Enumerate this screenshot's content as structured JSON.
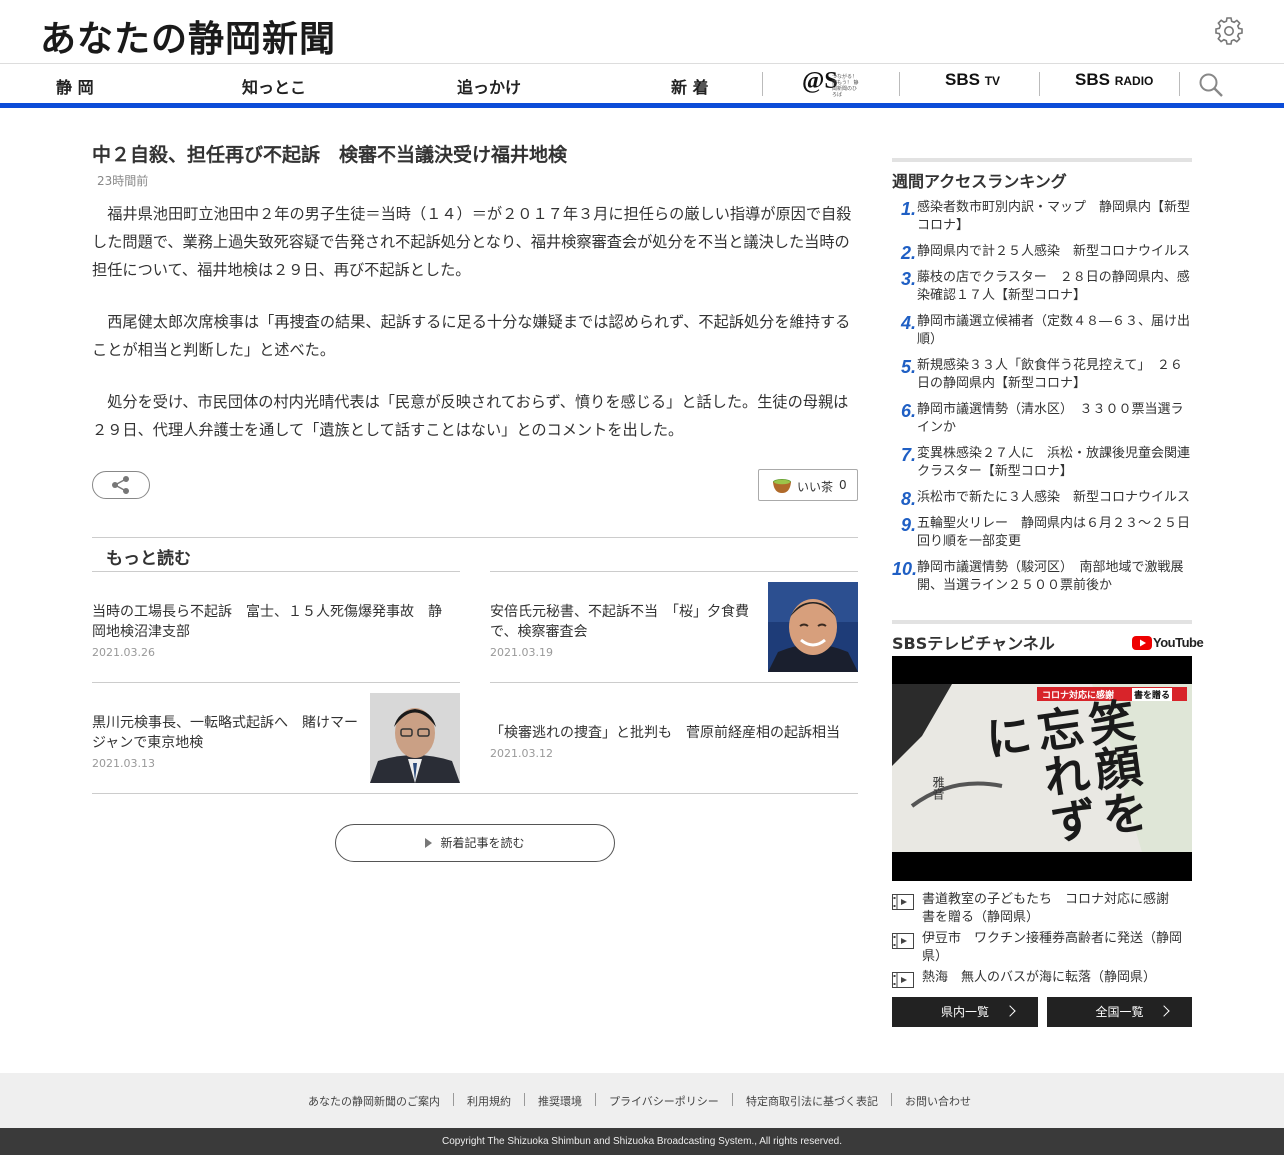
{
  "header": {
    "logo": "あなたの静岡新聞"
  },
  "nav": {
    "items": [
      "静 岡",
      "知っとこ",
      "追っかけ",
      "新 着"
    ],
    "at_s_tagline": "つながる！読もう！ 静岡新聞のひろば",
    "sbs_tv": "SBS",
    "sbs_tv_suffix": "TV",
    "sbs_radio": "SBS",
    "sbs_radio_suffix": "RADIO"
  },
  "article": {
    "title": "中２自殺、担任再び不起訴　検審不当議決受け福井地検",
    "time": "23時間前",
    "paragraphs": [
      "福井県池田町立池田中２年の男子生徒＝当時（１４）＝が２０１７年３月に担任らの厳しい指導が原因で自殺した問題で、業務上過失致死容疑で告発され不起訴処分となり、福井検察審査会が処分を不当と議決した当時の担任について、福井地検は２９日、再び不起訴とした。",
      "西尾健太郎次席検事は「再捜査の結果、起訴するに足る十分な嫌疑までは認められず、不起訴処分を維持することが相当と判断した」と述べた。",
      "処分を受け、市民団体の村内光晴代表は「民意が反映されておらず、憤りを感じる」と話した。生徒の母親は２９日、代理人弁護士を通して「遺族として話すことはない」とのコメントを出した。"
    ],
    "good_label": "いい茶",
    "good_count": "0"
  },
  "more": {
    "heading": "もっと読む",
    "items": [
      {
        "title": "当時の工場長ら不起訴　富士、１５人死傷爆発事故　静岡地検沼津支部",
        "date": "2021.03.26"
      },
      {
        "title": "安倍氏元秘書、不起訴不当　「桜」夕食費で、検察審査会",
        "date": "2021.03.19"
      },
      {
        "title": "黒川元検事長、一転略式起訴へ　賭けマージャンで東京地検",
        "date": "2021.03.13"
      },
      {
        "title": "「検審逃れの捜査」と批判も　菅原前経産相の起訴相当",
        "date": "2021.03.12"
      }
    ],
    "read_new": "新着記事を読む"
  },
  "sidebar": {
    "ranking_title": "週間アクセスランキング",
    "ranking": [
      {
        "n": "1.",
        "title": "感染者数市町別内訳・マップ　静岡県内【新型コロナ】"
      },
      {
        "n": "2.",
        "title": "静岡県内で計２５人感染　新型コロナウイルス"
      },
      {
        "n": "3.",
        "title": "藤枝の店でクラスター　２８日の静岡県内、感染確認１７人【新型コロナ】"
      },
      {
        "n": "4.",
        "title": "静岡市議選立候補者（定数４８―６３、届け出順）"
      },
      {
        "n": "5.",
        "title": "新規感染３３人「飲食伴う花見控えて」　２６日の静岡県内【新型コロナ】"
      },
      {
        "n": "6.",
        "title": "静岡市議選情勢（清水区）　３３００票当選ラインか"
      },
      {
        "n": "7.",
        "title": "変異株感染２７人に　浜松・放課後児童会関連クラスター【新型コロナ】"
      },
      {
        "n": "8.",
        "title": "浜松市で新たに３人感染　新型コロナウイルス"
      },
      {
        "n": "9.",
        "title": "五輪聖火リレー　静岡県内は６月２３～２５日　回り順を一部変更"
      },
      {
        "n": "10.",
        "title": "静岡市議選情勢（駿河区）　南部地域で激戦展開、当選ライン２５００票前後か"
      }
    ],
    "channel_title": "SBSテレビチャンネル",
    "youtube": "YouTube",
    "video_caption": "コロナ対応に感謝",
    "video_caption2": "書を贈る",
    "video_calligraphy": "笑顔を忘れずに",
    "video_signature": "雅音",
    "videos": [
      "書道教室の子どもたち　コロナ対応に感謝　書を贈る（静岡県）",
      "伊豆市　ワクチン接種券高齢者に発送（静岡県）",
      "熱海　無人のバスが海に転落（静岡県）"
    ],
    "btn_pref": "県内一覧",
    "btn_national": "全国一覧"
  },
  "footer": {
    "links": [
      "あなたの静岡新聞のご案内",
      "利用規約",
      "推奨環境",
      "プライバシーポリシー",
      "特定商取引法に基づく表記",
      "お問い合わせ"
    ],
    "copyright": "Copyright The Shizuoka Shimbun and Shizuoka Broadcasting System., All rights reserved."
  },
  "colors": {
    "accent": "#0c4cd8",
    "rank_number": "#1f5fc4",
    "footer_dark": "#3a3a3a"
  }
}
